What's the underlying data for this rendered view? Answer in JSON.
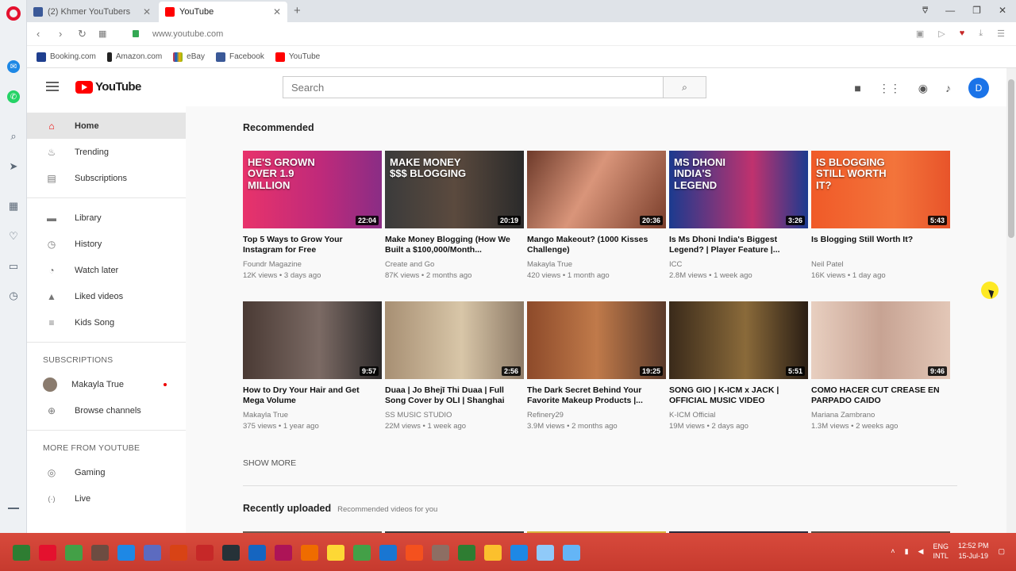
{
  "browser": {
    "tabs": [
      {
        "label": "(2) Khmer YouTubers",
        "favicon_color": "#3b5998"
      },
      {
        "label": "YouTube",
        "favicon_color": "#ff0000"
      }
    ],
    "url": "www.youtube.com",
    "bookmarks": [
      {
        "label": "Booking.com",
        "color": "#1f3f8f"
      },
      {
        "label": "Amazon.com",
        "color": "#222222"
      },
      {
        "label": "eBay",
        "color": "#e53238"
      },
      {
        "label": "Facebook",
        "color": "#3b5998"
      },
      {
        "label": "YouTube",
        "color": "#ff0000"
      }
    ]
  },
  "youtube": {
    "logo_text": "YouTube",
    "search_placeholder": "Search",
    "avatar_letter": "D",
    "sidebar": {
      "main": [
        {
          "label": "Home",
          "icon": "home-icon",
          "glyph": "⌂"
        },
        {
          "label": "Trending",
          "icon": "trending-icon",
          "glyph": "♨"
        },
        {
          "label": "Subscriptions",
          "icon": "subscriptions-icon",
          "glyph": "▤"
        }
      ],
      "library": [
        {
          "label": "Library",
          "icon": "library-icon",
          "glyph": "▬"
        },
        {
          "label": "History",
          "icon": "history-icon",
          "glyph": "◷"
        },
        {
          "label": "Watch later",
          "icon": "watch-later-icon",
          "glyph": "◔"
        },
        {
          "label": "Liked videos",
          "icon": "liked-icon",
          "glyph": "👍"
        },
        {
          "label": "Kids Song",
          "icon": "playlist-icon",
          "glyph": "≡"
        }
      ],
      "subscriptions_heading": "SUBSCRIPTIONS",
      "subscriptions": [
        {
          "label": "Makayla True"
        },
        {
          "label": "Browse channels"
        }
      ],
      "more_heading": "MORE FROM YOUTUBE",
      "more": [
        {
          "label": "Gaming",
          "icon": "gaming-icon",
          "glyph": "◎"
        },
        {
          "label": "Live",
          "icon": "live-icon",
          "glyph": "((·))"
        }
      ]
    },
    "recommended_title": "Recommended",
    "videos_row1": [
      {
        "title": "Top 5 Ways to Grow Your Instagram for Free",
        "channel": "Foundr Magazine",
        "meta": "12K views • 3 days ago",
        "duration": "22:04",
        "thumb_text": "HE'S GROWN OVER 1.9 MILLION",
        "bg": "linear-gradient(90deg,#e8336b 0%,#c02a7a 55%,#8a2d85 100%)"
      },
      {
        "title": "Make Money Blogging (How We Built a $100,000/Month...",
        "channel": "Create and Go",
        "meta": "87K views • 2 months ago",
        "duration": "20:19",
        "thumb_text": "MAKE MONEY $$$ BLOGGING",
        "bg": "linear-gradient(90deg,#3b3b3b 0%,#5b4a3e 50%,#2a2a2a 100%)"
      },
      {
        "title": "Mango Makeout? (1000 Kisses Challenge)",
        "channel": "Makayla True",
        "meta": "420 views • 1 month ago",
        "duration": "20:36",
        "thumb_text": "",
        "bg": "linear-gradient(120deg,#6d3a2a 0%,#d9957a 45%,#7a3e2b 100%)"
      },
      {
        "title": "Is Ms Dhoni India's Biggest Legend? | Player Feature |...",
        "channel": "ICC",
        "meta": "2.8M views • 1 week ago",
        "duration": "3:26",
        "thumb_text": "MS DHONI INDIA'S LEGEND",
        "bg": "linear-gradient(90deg,#1b3a8f 0%,#c0326e 60%,#1b3a8f 100%)"
      },
      {
        "title": "Is Blogging Still Worth It?",
        "channel": "Neil Patel",
        "meta": "16K views • 1 day ago",
        "duration": "5:43",
        "thumb_text": "IS BLOGGING STILL WORTH IT?",
        "bg": "linear-gradient(90deg,#f05a28 0%,#f3743b 60%,#e8542a 100%)"
      }
    ],
    "videos_row2": [
      {
        "title": "How to Dry Your Hair and Get Mega Volume",
        "channel": "Makayla True",
        "meta": "375 views • 1 year ago",
        "duration": "9:57",
        "bg": "linear-gradient(90deg,#4a3a34 0%,#7b6a64 55%,#2d2a2a 100%)"
      },
      {
        "title": "Duaa | Jo Bhejī Thi Duaa | Full Song Cover by OLI | Shanghai",
        "channel": "SS MUSIC STUDIO",
        "meta": "22M views • 1 week ago",
        "duration": "2:56",
        "bg": "linear-gradient(90deg,#a78f73 0%,#d8c6a8 55%,#8d7a66 100%)"
      },
      {
        "title": "The Dark Secret Behind Your Favorite Makeup Products |...",
        "channel": "Refinery29",
        "meta": "3.9M views • 2 months ago",
        "duration": "19:25",
        "bg": "linear-gradient(90deg,#8d4a2a 0%,#c07a4a 50%,#5a3a2a 100%)"
      },
      {
        "title": "SONG GIO | K-ICM x JACK | OFFICIAL MUSIC VIDEO",
        "channel": "K-ICM Official",
        "meta": "19M views • 2 days ago",
        "duration": "5:51",
        "bg": "linear-gradient(90deg,#3a2a1a 0%,#8a6a3a 55%,#2a1e14 100%)"
      },
      {
        "title": "COMO HACER CUT CREASE EN PARPADO CAIDO",
        "channel": "Mariana Zambrano",
        "meta": "1.3M views • 2 weeks ago",
        "duration": "9:46",
        "bg": "linear-gradient(90deg,#e8cfc0 0%,#c7a393 50%,#e3c7b7 100%)"
      }
    ],
    "show_more": "SHOW MORE",
    "recent_title": "Recently uploaded",
    "recent_subtitle": "Recommended videos for you"
  },
  "taskbar": {
    "lang_top": "ENG",
    "lang_bottom": "INTL",
    "time": "12:52 PM",
    "date": "15-Jul-19",
    "icon_colors": [
      "#2e7d32",
      "#e4112e",
      "#43a047",
      "#6d4c41",
      "#1e88e5",
      "#5c6bc0",
      "#d84315",
      "#c62828",
      "#263238",
      "#1565c0",
      "#ad1457",
      "#ef6c00",
      "#fdd835",
      "#43a047",
      "#1976d2",
      "#f4511e",
      "#8d6e63",
      "#2e7d32",
      "#fbc02d",
      "#1e88e5",
      "#90caf9",
      "#64b5f6"
    ]
  }
}
